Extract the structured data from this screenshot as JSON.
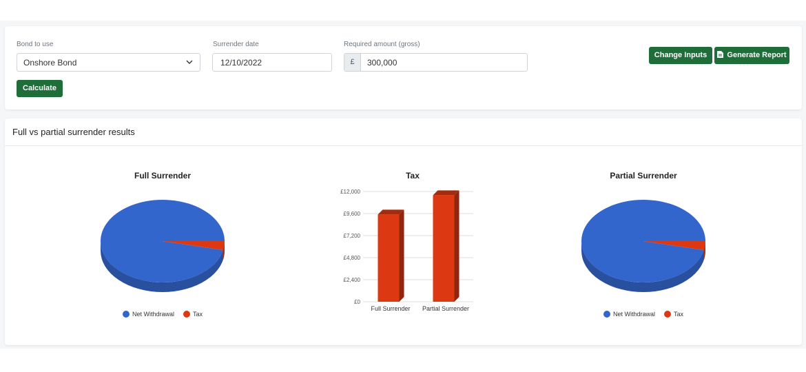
{
  "form": {
    "bond_label": "Bond to use",
    "bond_value": "Onshore Bond",
    "date_label": "Surrender date",
    "date_value": "12/10/2022",
    "amount_label": "Required amount (gross)",
    "amount_prefix": "£",
    "amount_value": "300,000",
    "calculate_label": "Calculate"
  },
  "toolbar": {
    "change_inputs_label": "Change Inputs",
    "generate_report_label": "Generate Report"
  },
  "results": {
    "title": "Full vs partial surrender results"
  },
  "colors": {
    "primary_button": "#1f6e3a",
    "net_withdrawal": "#3366cc",
    "tax": "#dc3912"
  },
  "chart_data": [
    {
      "type": "pie",
      "title": "Full Surrender",
      "labels": [
        "Net Withdrawal",
        "Tax"
      ],
      "values": [
        96.5,
        3.5
      ],
      "legend": "bottom"
    },
    {
      "type": "bar",
      "title": "Tax",
      "categories": [
        "Full Surrender",
        "Partial Surrender"
      ],
      "series": [
        {
          "values": [
            9500,
            11600
          ]
        }
      ],
      "ylim": [
        0,
        12000
      ],
      "yticks": [
        "£0",
        "£2,400",
        "£4,800",
        "£7,200",
        "£9,600",
        "£12,000"
      ],
      "grid": true
    },
    {
      "type": "pie",
      "title": "Partial Surrender",
      "labels": [
        "Net Withdrawal",
        "Tax"
      ],
      "values": [
        96.5,
        3.5
      ],
      "legend": "bottom"
    }
  ]
}
